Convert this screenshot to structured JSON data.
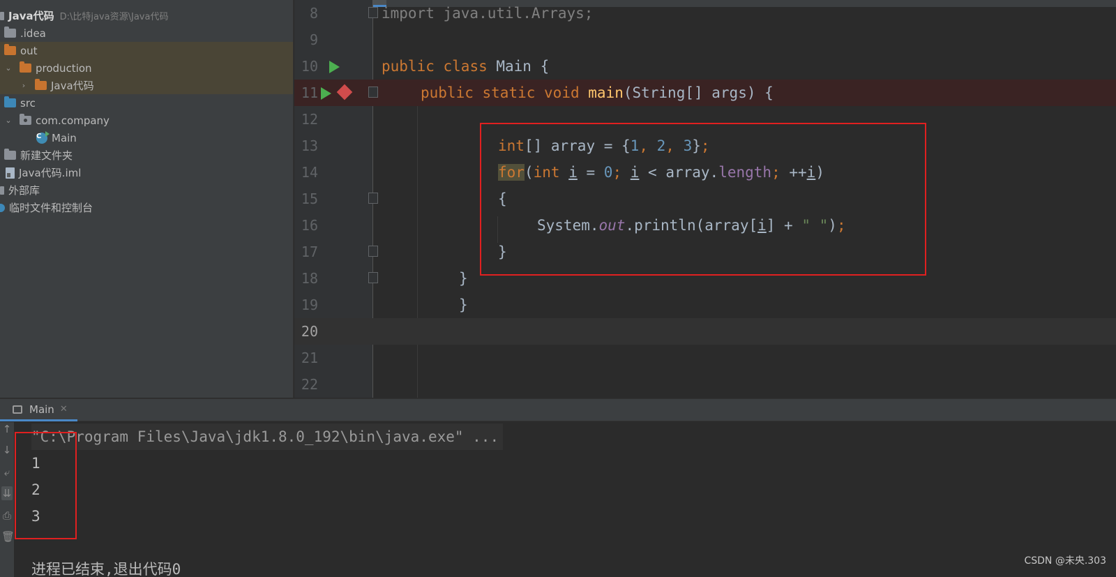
{
  "project": {
    "root": {
      "name": "Java代码",
      "path": "D:\\比特java资源\\Java代码"
    },
    "items": [
      {
        "label": ".idea"
      },
      {
        "label": "out"
      },
      {
        "label": "production"
      },
      {
        "label": "Java代码"
      },
      {
        "label": "src"
      },
      {
        "label": "com.company"
      },
      {
        "label": "Main"
      },
      {
        "label": "新建文件夹"
      },
      {
        "label": "Java代码.iml"
      },
      {
        "label": "外部库"
      },
      {
        "label": "临时文件和控制台"
      }
    ]
  },
  "editor": {
    "line_numbers": [
      "8",
      "9",
      "10",
      "11",
      "12",
      "13",
      "14",
      "15",
      "16",
      "17",
      "18",
      "19",
      "20",
      "21",
      "22"
    ],
    "code": {
      "l8": {
        "a": "import java.util.Arrays;"
      },
      "l10": {
        "kw1": "public",
        "kw2": "class",
        "rest": " Main {"
      },
      "l11": {
        "kw1": "public",
        "kw2": "static",
        "kw3": "void",
        "fn": "main",
        "rest": "(String[] args) {"
      },
      "l13": {
        "kw": "int",
        "a": "[] array = {",
        "n1": "1",
        "c1": ", ",
        "n2": "2",
        "c2": ", ",
        "n3": "3",
        "b": "}",
        "semi": ";"
      },
      "l14": {
        "kw": "for",
        "a": "(",
        "kw2": "int",
        "b": " ",
        "i1": "i",
        "c": " = ",
        "n": "0",
        "semi": ";",
        "d": " ",
        "i2": "i",
        "e": " < array.",
        "fld": "length",
        "semi2": ";",
        "f": " ++",
        "i3": "i",
        "g": ")"
      },
      "l15": {
        "a": "{"
      },
      "l16": {
        "a": "System.",
        "out": "out",
        "b": ".println(array[",
        "i": "i",
        "c": "] + ",
        "str": "\" \"",
        "d": ")",
        "semi": ";"
      },
      "l17": {
        "a": "}"
      },
      "l18": {
        "a": "}"
      },
      "l19": {
        "a": "}"
      }
    }
  },
  "run": {
    "tab_label": "Main",
    "command": "\"C:\\Program Files\\Java\\jdk1.8.0_192\\bin\\java.exe\" ...",
    "output": [
      "1",
      "2",
      "3"
    ],
    "exit_message": "进程已结束,退出代码0"
  },
  "watermark": "CSDN @未央.303",
  "colors": {
    "keyword": "#cc7832",
    "number": "#6897bb",
    "string": "#6a8759",
    "field": "#9876aa",
    "function": "#ffc66d",
    "highlight_box": "#e02020"
  }
}
